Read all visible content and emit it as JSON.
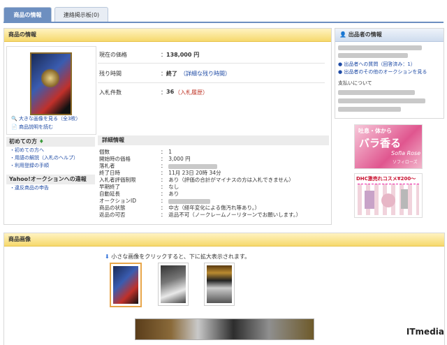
{
  "tabs": [
    {
      "label": "商品の情報"
    },
    {
      "label": "連絡掲示板(0)"
    }
  ],
  "product": {
    "title": "商品の情報",
    "enlarge_link": "大きな画像を見る（全3枚）",
    "desc_link": "商品説明を読む",
    "rows": [
      {
        "label": "現在の価格",
        "value": "138,000 円",
        "note": ""
      },
      {
        "label": "残り時間",
        "value": "終了",
        "note": "（詳細な残り時間）"
      },
      {
        "label": "入札件数",
        "value": "36",
        "note": "（入札履歴）"
      }
    ]
  },
  "beginner": {
    "title": "初めての方",
    "items": [
      "初めての方へ",
      "用語の解説（入札のヘルプ）",
      "利用登録の手順"
    ]
  },
  "violation": {
    "title": "Yahoo!オークションへの違報",
    "items": [
      "違反商品の申告"
    ]
  },
  "details": {
    "title": "詳細情報",
    "rows": [
      {
        "label": "個数",
        "value": "1"
      },
      {
        "label": "開始時の価格",
        "value": "3,000 円"
      },
      {
        "label": "落札者",
        "value": ""
      },
      {
        "label": "終了日時",
        "value": "11月 23日 20時 34分"
      },
      {
        "label": "入札者評価制限",
        "value": "あり（評価の合計がマイナスの方は入札できません）"
      },
      {
        "label": "早期終了",
        "value": "なし"
      },
      {
        "label": "自動延長",
        "value": "あり"
      },
      {
        "label": "オークションID",
        "value": ""
      },
      {
        "label": "商品の状態",
        "value": "中古（経年変化による傷汚れ等あり。）"
      },
      {
        "label": "返品の可否",
        "value": "返品不可（ノークレームノーリターンでお願いします。）"
      }
    ]
  },
  "seller": {
    "title": "出品者の情報",
    "question_link": "出品者への質問（回答済み：1）",
    "other_link": "出品者のその他のオークションを見る",
    "payment": "支払いについて"
  },
  "ads": {
    "ad1_top": "吐息・体から",
    "ad1_main": "バラ香る",
    "ad1_brand": "Sofia Rose",
    "ad1_sub": "ソフィローズ",
    "ad2_title": "DHC激売れコスメ¥200～"
  },
  "images_section": {
    "title": "商品画像",
    "hint": "小さな画像をクリックすると、下に拡大表示されます。"
  },
  "footer": {
    "logo": "ITmedia"
  }
}
